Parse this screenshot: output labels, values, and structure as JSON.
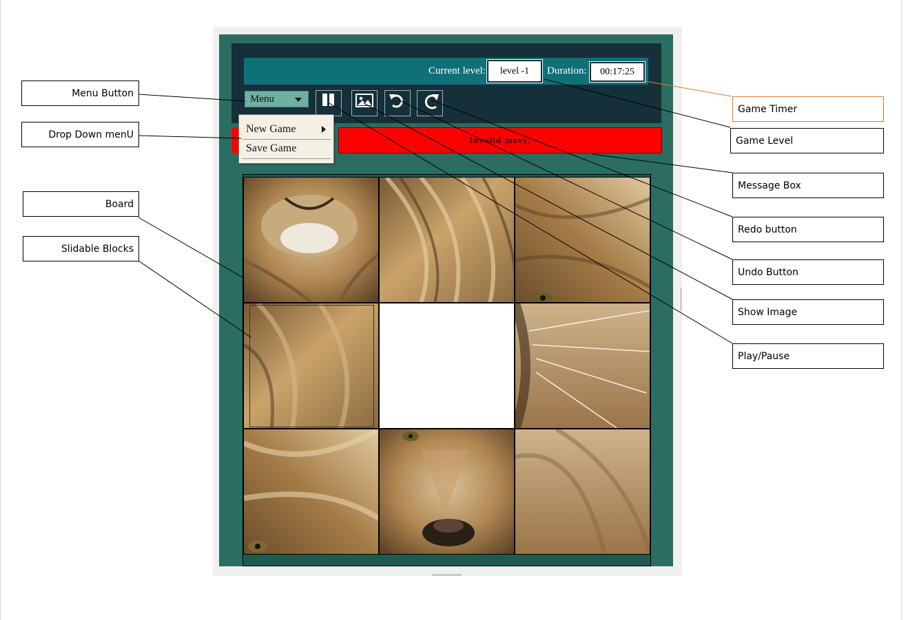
{
  "game": {
    "current_level_label": "Current level:",
    "current_level_value": "level -1",
    "duration_label": "Duration:",
    "duration_value": "00:17:25",
    "menu_label": "Menu",
    "message": "Invalid move."
  },
  "menu": {
    "items": [
      {
        "label": "New Game",
        "has_submenu": true
      },
      {
        "label": "Save Game",
        "has_submenu": false
      }
    ]
  },
  "toolbar": {
    "buttons": [
      {
        "name": "play-pause",
        "icon": "pause-icon"
      },
      {
        "name": "show-image",
        "icon": "image-icon"
      },
      {
        "name": "undo",
        "icon": "undo-icon"
      },
      {
        "name": "redo",
        "icon": "redo-icon"
      }
    ]
  },
  "board": {
    "rows": 3,
    "cols": 3,
    "empty_cell": {
      "row": 1,
      "col": 1
    },
    "selected_cell": {
      "row": 1,
      "col": 0
    }
  },
  "annotations": {
    "menu_button": "Menu Button",
    "drop_down_menu": "Drop Down menU",
    "board": "Board",
    "slidable_blocks": "Slidable Blocks",
    "game_timer": "Game Timer",
    "game_level": "Game Level",
    "message_box": "Message Box",
    "redo_button": "Redo button",
    "undo_button": "Undo Button",
    "show_image": "Show Image",
    "play_pause": "Play/Pause"
  },
  "colors": {
    "app_background": "#2b6d61",
    "toolbar_background": "#16303a",
    "info_bar": "#0f7078",
    "menu_button": "#6fb0a3",
    "message_box": "#ff0000",
    "timer_callout_border": "#e07a1f"
  }
}
